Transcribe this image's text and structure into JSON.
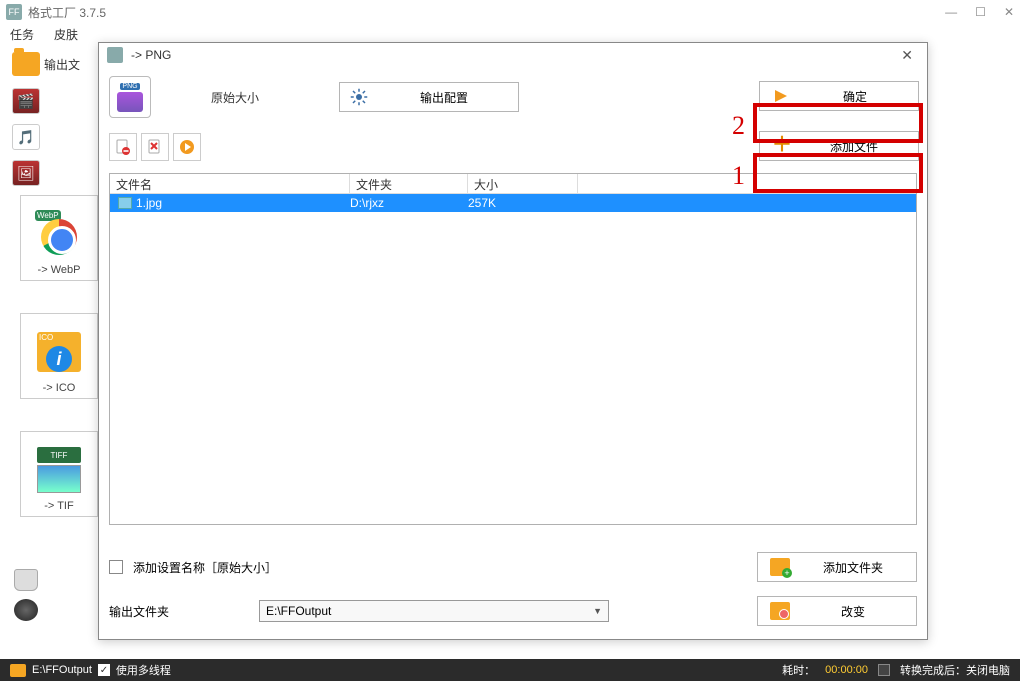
{
  "mainWindow": {
    "title": "格式工厂 3.7.5",
    "menu": {
      "task": "任务",
      "skin": "皮肤"
    },
    "outputBar": "输出文",
    "formatButtons": {
      "webp": {
        "badge": "WebP",
        "label": "-> WebP"
      },
      "ico": {
        "badge": "ICO",
        "label": "-> ICO"
      },
      "tif": {
        "badge": "TIFF",
        "label": "-> TIF"
      }
    }
  },
  "dialog": {
    "title": "-> PNG",
    "pngBadge": "PNG",
    "origSize": "原始大小",
    "outputConfig": "输出配置",
    "okBtn": "确定",
    "addFileBtn": "添加文件",
    "hl1": "1",
    "hl2": "2",
    "fileList": {
      "colName": "文件名",
      "colFolder": "文件夹",
      "colSize": "大小",
      "row": {
        "name": "1.jpg",
        "folder": "D:\\rjxz",
        "size": "257K"
      }
    },
    "addSettingName": "添加设置名称［原始大小］",
    "outputFolderLabel": "输出文件夹",
    "outputFolder": "E:\\FFOutput",
    "addFolderBtn": "添加文件夹",
    "changeBtn": "改变"
  },
  "statusBar": {
    "path": "E:\\FFOutput",
    "multiThread": "使用多线程",
    "elapsedLabel": "耗时：",
    "elapsed": "00:00:00",
    "afterFinish": "转换完成后：关闭电脑"
  }
}
